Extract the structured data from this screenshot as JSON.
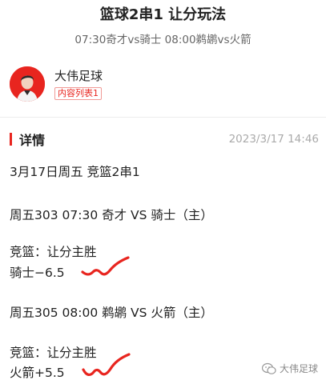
{
  "header": {
    "title": "篮球2串1 让分玩法",
    "subtitle": "07:30奇才vs骑士 08:00鹈鹕vs火箭"
  },
  "author": {
    "name": "大伟足球",
    "badge": "内容列表1"
  },
  "section": {
    "title": "详情",
    "date": "2023/3/17 14:46"
  },
  "content": {
    "line1": "3月17日周五 竞篮2串1",
    "match1": "周五303 07:30 奇才 VS 骑士（主）",
    "pick1_type": "竞篮：让分主胜",
    "pick1_value": "骑士−6.5",
    "match2": "周五305 08:00 鹈鹕 VS 火箭（主）",
    "pick2_type": "竞篮：让分主胜",
    "pick2_value": "火箭+5.5"
  },
  "watermark": {
    "text": "大伟足球"
  },
  "colors": {
    "accent": "#e8251f",
    "squiggle": "#e8251f"
  }
}
